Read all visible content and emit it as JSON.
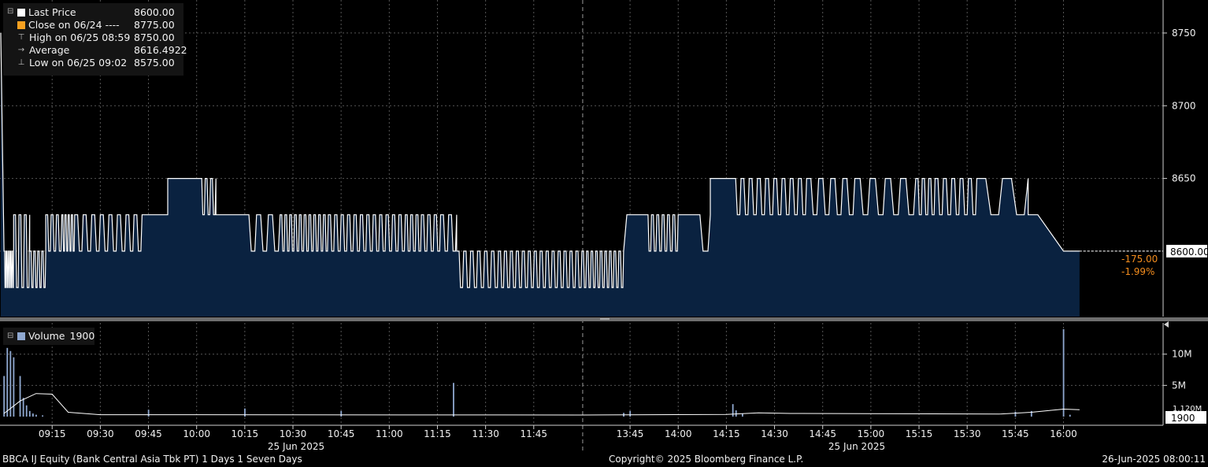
{
  "legend_price": [
    {
      "marker": "square",
      "color": "#ffffff",
      "label": "Last Price",
      "value": "8600.00"
    },
    {
      "marker": "square",
      "color": "#f5a020",
      "label": "Close on 06/24 ----",
      "value": "8775.00"
    },
    {
      "marker": "high-icon",
      "label": "High on 06/25 08:59",
      "value": "8750.00"
    },
    {
      "marker": "average-icon",
      "label": "Average",
      "value": "8616.4922"
    },
    {
      "marker": "low-icon",
      "label": "Low on 06/25 09:02",
      "value": "8575.00"
    }
  ],
  "legend_volume": {
    "color": "#8fa8d0",
    "label": "Volume",
    "value": "1900"
  },
  "change": {
    "abs": "-175.00",
    "pct": "-1.99%",
    "color": "#f28c1e"
  },
  "footer": {
    "left": "BBCA IJ Equity (Bank Central Asia Tbk PT) 1 Days 1 Seven Days",
    "center": "Copyright© 2025 Bloomberg Finance L.P.",
    "right": "26-Jun-2025 08:00:11"
  },
  "colors": {
    "fill": "#0a2240",
    "line": "#ffffff",
    "volume": "#8fa8d0",
    "grid": "#555555",
    "avg_line": "#ffffff"
  },
  "chart_data": [
    {
      "type": "area",
      "series_name": "Last Price",
      "x_unit": "time of day (25 Jun 2025, lunch break 12:00-13:30)",
      "ylim": [
        8555,
        8770
      ],
      "yticks": [
        8650,
        8700,
        8750
      ],
      "last_price_label": "8600.00",
      "date_labels": [
        "25 Jun 2025",
        "25 Jun 2025"
      ],
      "xticks": [
        "09:15",
        "09:30",
        "09:45",
        "10:00",
        "10:15",
        "10:30",
        "10:45",
        "11:00",
        "11:15",
        "11:30",
        "11:45",
        "13:45",
        "14:00",
        "14:15",
        "14:30",
        "14:45",
        "15:00",
        "15:15",
        "15:30",
        "15:45",
        "16:00"
      ],
      "grid": true,
      "segments": [
        {
          "t": [
            "09:00",
            "09:03"
          ],
          "range": [
            8575,
            8600
          ],
          "n": 5
        },
        {
          "t": [
            "09:03",
            "09:08"
          ],
          "range": [
            8575,
            8625
          ],
          "n": 3
        },
        {
          "t": [
            "09:08",
            "09:13"
          ],
          "range": [
            8575,
            8600
          ],
          "n": 4
        },
        {
          "t": [
            "09:13",
            "09:18"
          ],
          "range": [
            8600,
            8625
          ],
          "n": 3
        },
        {
          "t": [
            "09:18",
            "09:22"
          ],
          "range": [
            8600,
            8625
          ],
          "n": 4
        },
        {
          "t": [
            "09:22",
            "09:30"
          ],
          "range": [
            8600,
            8625
          ],
          "n": 3
        },
        {
          "t": [
            "09:30",
            "09:38"
          ],
          "range": [
            8600,
            8625
          ],
          "n": 3
        },
        {
          "t": [
            "09:38",
            "09:43"
          ],
          "range": [
            8600,
            8625
          ],
          "n": 2
        },
        {
          "t": [
            "09:44",
            "09:51"
          ],
          "range": [
            8625,
            8625
          ],
          "n": 0
        },
        {
          "t": [
            "09:51",
            "10:01"
          ],
          "range": [
            8650,
            8650
          ],
          "n": 0
        },
        {
          "t": [
            "10:01",
            "10:06"
          ],
          "range": [
            8625,
            8650
          ],
          "n": 3
        },
        {
          "t": [
            "10:06",
            "10:15"
          ],
          "range": [
            8625,
            8625
          ],
          "n": 0
        },
        {
          "t": [
            "10:15",
            "10:26"
          ],
          "range": [
            8600,
            8625
          ],
          "n": 3
        },
        {
          "t": [
            "10:26",
            "10:41"
          ],
          "range": [
            8600,
            8625
          ],
          "n": 10
        },
        {
          "t": [
            "10:41",
            "11:05"
          ],
          "range": [
            8600,
            8625
          ],
          "n": 12
        },
        {
          "t": [
            "11:05",
            "11:10"
          ],
          "range": [
            8600,
            8625
          ],
          "n": 3
        },
        {
          "t": [
            "11:10",
            "11:16"
          ],
          "range": [
            8600,
            8625
          ],
          "n": 3
        },
        {
          "t": [
            "11:16",
            "11:21"
          ],
          "range": [
            8600,
            8625
          ],
          "n": 2
        },
        {
          "t": [
            "11:21",
            "11:34"
          ],
          "range": [
            8575,
            8600
          ],
          "n": 6
        },
        {
          "t": [
            "11:34",
            "12:00"
          ],
          "range": [
            8575,
            8600
          ],
          "n": 14
        },
        {
          "t": [
            "13:30",
            "13:40"
          ],
          "range": [
            8575,
            8600
          ],
          "n": 7
        },
        {
          "t": [
            "13:40",
            "13:43"
          ],
          "range": [
            8575,
            8600
          ],
          "n": 2
        },
        {
          "t": [
            "13:44",
            "13:50"
          ],
          "range": [
            8625,
            8625
          ],
          "n": 0
        },
        {
          "t": [
            "13:50",
            "14:00"
          ],
          "range": [
            8600,
            8625
          ],
          "n": 6
        },
        {
          "t": [
            "14:00",
            "14:04"
          ],
          "range": [
            8625,
            8625
          ],
          "n": 0
        },
        {
          "t": [
            "14:05",
            "14:10"
          ],
          "range": [
            8600,
            8625
          ],
          "n": 1
        },
        {
          "t": [
            "14:10",
            "14:17"
          ],
          "range": [
            8650,
            8650
          ],
          "n": 0
        },
        {
          "t": [
            "14:17",
            "14:40"
          ],
          "range": [
            8625,
            8650
          ],
          "n": 9
        },
        {
          "t": [
            "14:40",
            "14:55"
          ],
          "range": [
            8625,
            8650
          ],
          "n": 4
        },
        {
          "t": [
            "14:55",
            "15:14"
          ],
          "range": [
            8625,
            8650
          ],
          "n": 4
        },
        {
          "t": [
            "15:14",
            "15:20"
          ],
          "range": [
            8625,
            8650
          ],
          "n": 3
        },
        {
          "t": [
            "15:20",
            "15:33"
          ],
          "range": [
            8625,
            8650
          ],
          "n": 5
        },
        {
          "t": [
            "15:33",
            "15:49"
          ],
          "range": [
            8625,
            8650
          ],
          "n": 2
        },
        {
          "t": [
            "15:49",
            "15:52"
          ],
          "range": [
            8625,
            8625
          ],
          "n": 0
        }
      ],
      "points": [
        [
          "08:59",
          8750
        ],
        [
          "09:00",
          8600
        ],
        [
          "15:52",
          8625
        ],
        [
          "16:00",
          8600
        ],
        [
          "16:05",
          8600
        ]
      ]
    },
    {
      "type": "bar",
      "series_name": "Volume",
      "ylim": [
        0,
        14000000
      ],
      "yticks": [
        {
          "value": 5000000,
          "label": "5M"
        },
        {
          "value": 10000000,
          "label": "10M"
        }
      ],
      "last_value_label": "1900",
      "partial_label": "1.120M",
      "bars": [
        [
          "09:00",
          6500000
        ],
        [
          "09:01",
          11000000
        ],
        [
          "09:02",
          10500000
        ],
        [
          "09:03",
          9500000
        ],
        [
          "09:05",
          6500000
        ],
        [
          "09:06",
          3000000
        ],
        [
          "09:07",
          1800000
        ],
        [
          "09:08",
          900000
        ],
        [
          "09:09",
          500000
        ],
        [
          "09:10",
          300000
        ],
        [
          "09:12",
          200000
        ],
        [
          "09:45",
          1100000
        ],
        [
          "10:15",
          1300000
        ],
        [
          "10:45",
          900000
        ],
        [
          "11:20",
          5400000
        ],
        [
          "13:43",
          600000
        ],
        [
          "13:45",
          900000
        ],
        [
          "14:17",
          2000000
        ],
        [
          "14:18",
          1000000
        ],
        [
          "14:20",
          500000
        ],
        [
          "15:45",
          800000
        ],
        [
          "15:50",
          900000
        ],
        [
          "16:00",
          14000000
        ],
        [
          "16:02",
          300000
        ]
      ],
      "avg_line": [
        [
          "09:00",
          500000
        ],
        [
          "09:05",
          2500000
        ],
        [
          "09:10",
          3700000
        ],
        [
          "09:15",
          3600000
        ],
        [
          "09:20",
          700000
        ],
        [
          "09:30",
          300000
        ],
        [
          "12:00",
          250000
        ],
        [
          "13:30",
          250000
        ],
        [
          "14:15",
          350000
        ],
        [
          "14:25",
          600000
        ],
        [
          "14:35",
          500000
        ],
        [
          "15:40",
          400000
        ],
        [
          "15:50",
          700000
        ],
        [
          "16:00",
          1200000
        ],
        [
          "16:05",
          1100000
        ]
      ]
    }
  ]
}
